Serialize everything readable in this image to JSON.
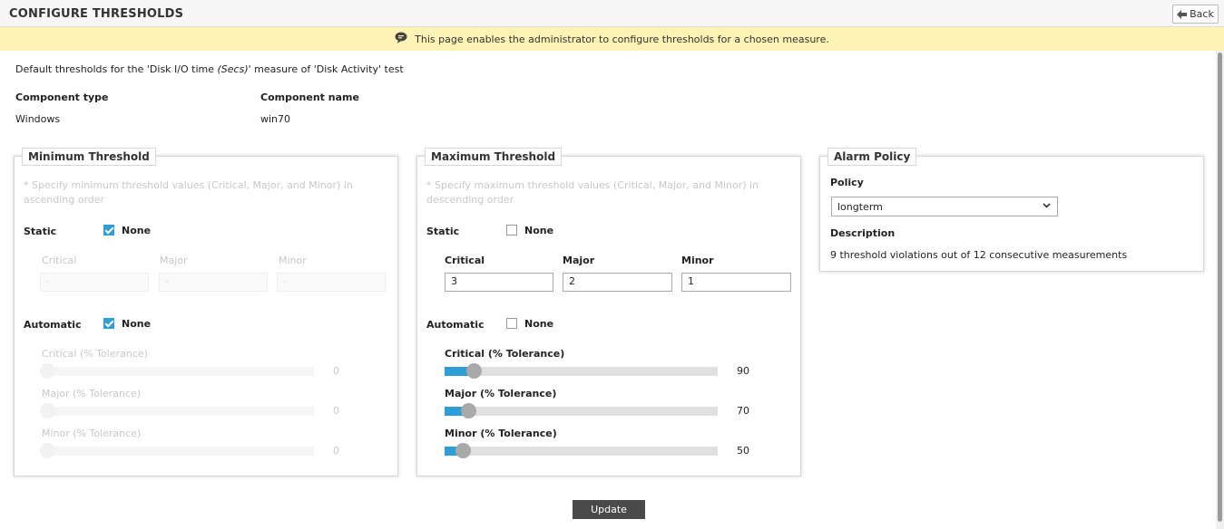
{
  "header": {
    "title": "CONFIGURE THRESHOLDS",
    "back_label": "Back"
  },
  "info_bar": {
    "message": "This page enables the administrator to configure thresholds for a chosen measure."
  },
  "description": {
    "prefix": "Default thresholds for the 'Disk I/O time",
    "unit": "(Secs)'",
    "suffix": "measure of 'Disk Activity' test"
  },
  "component": {
    "type_label": "Component type",
    "type_value": "Windows",
    "name_label": "Component name",
    "name_value": "win70"
  },
  "min_threshold": {
    "title": "Minimum Threshold",
    "note": "* Specify minimum threshold values (Critical, Major, and Minor) in ascending order",
    "static_label": "Static",
    "static_none_label": "None",
    "static_none_checked": true,
    "critical_label": "Critical",
    "major_label": "Major",
    "minor_label": "Minor",
    "critical_value": "-",
    "major_value": "-",
    "minor_value": "-",
    "automatic_label": "Automatic",
    "automatic_none_label": "None",
    "automatic_none_checked": true,
    "critical_tol_label": "Critical (% Tolerance)",
    "critical_tol_value": "0",
    "major_tol_label": "Major (% Tolerance)",
    "major_tol_value": "0",
    "minor_tol_label": "Minor (% Tolerance)",
    "minor_tol_value": "0"
  },
  "max_threshold": {
    "title": "Maximum Threshold",
    "note": "* Specify maximum threshold values (Critical, Major, and Minor) in descending order",
    "static_label": "Static",
    "static_none_label": "None",
    "static_none_checked": false,
    "critical_label": "Critical",
    "major_label": "Major",
    "minor_label": "Minor",
    "critical_value": "3",
    "major_value": "2",
    "minor_value": "1",
    "automatic_label": "Automatic",
    "automatic_none_label": "None",
    "automatic_none_checked": false,
    "critical_tol_label": "Critical (% Tolerance)",
    "critical_tol_value": "90",
    "major_tol_label": "Major (% Tolerance)",
    "major_tol_value": "70",
    "minor_tol_label": "Minor (% Tolerance)",
    "minor_tol_value": "50"
  },
  "alarm_policy": {
    "title": "Alarm Policy",
    "policy_label": "Policy",
    "policy_value": "longterm",
    "description_label": "Description",
    "description_value": "9 threshold violations out of 12 consecutive measurements"
  },
  "actions": {
    "update_label": "Update"
  },
  "colors": {
    "accent": "#2e9fd6",
    "info_bar": "#fdf3b5",
    "button": "#4a4a4a"
  },
  "icons": {
    "back": "back-arrow-icon",
    "info": "speech-bubble-icon",
    "dropdown": "chevron-down-icon"
  }
}
